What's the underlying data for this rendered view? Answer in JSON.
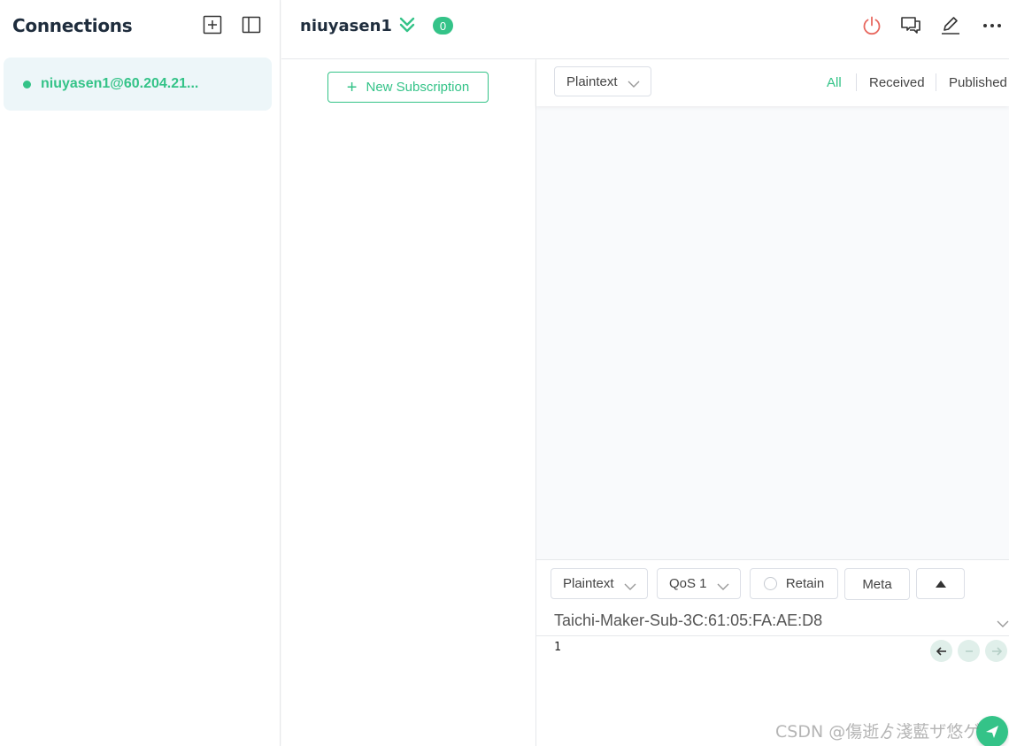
{
  "sidebar": {
    "title": "Connections",
    "add_icon": "plus-square-icon",
    "layout_icon": "sidebar-layout-icon",
    "connections": [
      {
        "label": "niuyasen1@60.204.21...",
        "status": "connected"
      }
    ]
  },
  "topbar": {
    "title": "niuyasen1",
    "message_count": "0",
    "icons": [
      "power-icon",
      "chat-icon",
      "edit-icon",
      "more-icon"
    ]
  },
  "subscriptions": {
    "new_label": "New Subscription"
  },
  "messages": {
    "format": "Plaintext",
    "filters": [
      "All",
      "Received",
      "Published"
    ],
    "active_filter": "All"
  },
  "publish": {
    "format": "Plaintext",
    "qos": "QoS 1",
    "retain_label": "Retain",
    "meta_label": "Meta",
    "topic": "Taichi-Maker-Sub-3C:61:05:FA:AE:D8",
    "payload": "1"
  },
  "watermark": "CSDN @傷逝ゟ淺藍ザ悠ゲ",
  "colors": {
    "accent": "#34c388",
    "danger": "#e8685f",
    "selected_bg": "#edf6f9"
  }
}
